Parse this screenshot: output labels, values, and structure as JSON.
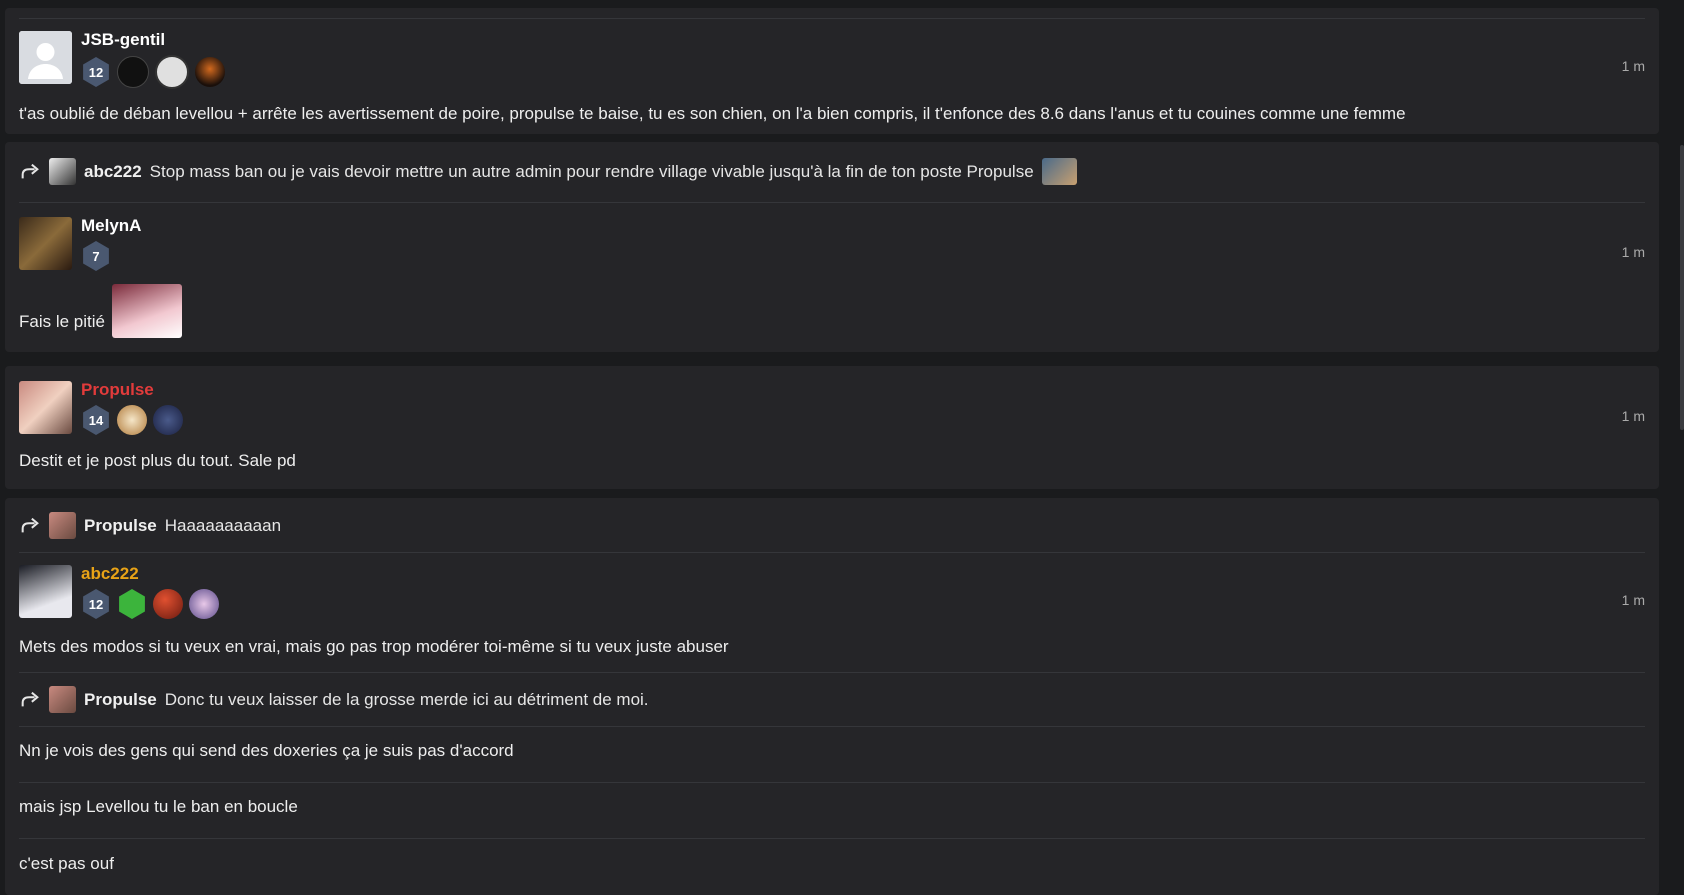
{
  "colors": {
    "background": "#1a1b1d",
    "card": "#252528",
    "username_default": "#ffffff",
    "username_admin": "#e23b3b",
    "username_moderator": "#e8a317",
    "level_badge": "#4a5870"
  },
  "posts": [
    {
      "username": "JSB-gentil",
      "level": "12",
      "time": "1 m",
      "message": "t'as oublié de déban levellou + arrête les avertissement de poire, propulse te baise, tu es son chien, on l'a bien compris, il t'enfonce des 8.6 dans l'anus et tu couines comme une femme"
    },
    {
      "reply": {
        "username": "abc222",
        "text": "Stop mass ban ou je vais devoir mettre un autre admin pour rendre village vivable jusqu'à la fin de ton poste Propulse"
      },
      "username": "MelynA",
      "level": "7",
      "time": "1 m",
      "message": "Fais le pitié"
    },
    {
      "username": "Propulse",
      "level": "14",
      "time": "1 m",
      "message": "Destit et je post plus du tout. Sale pd"
    },
    {
      "reply": {
        "username": "Propulse",
        "text": "Haaaaaaaaaan"
      },
      "username": "abc222",
      "level": "12",
      "time": "1 m",
      "message": "Mets des modos si tu veux en vrai, mais go pas trop modérer toi-même si tu veux juste abuser",
      "reply2": {
        "username": "Propulse",
        "text": "Donc tu veux laisser de la grosse merde ici au détriment de moi."
      },
      "followups": [
        "Nn je vois des gens qui send des doxeries ça je suis pas d'accord",
        "mais jsp Levellou tu le ban en boucle",
        "c'est pas ouf"
      ]
    }
  ]
}
